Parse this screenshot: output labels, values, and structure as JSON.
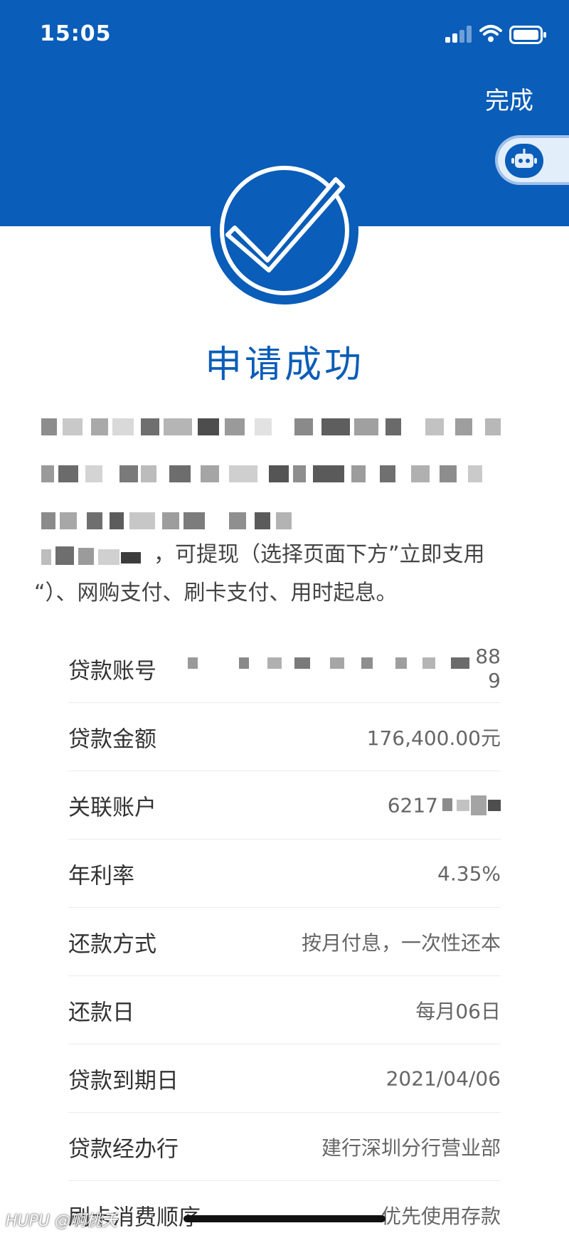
{
  "status_bar": {
    "time": "15:05",
    "icons": [
      "signal-icon",
      "wifi-icon",
      "battery-icon"
    ]
  },
  "header": {
    "done_label": "完成",
    "assistant_icon": "robot-icon",
    "bg_color": "#0a5db8"
  },
  "result": {
    "icon": "check-circle-icon",
    "title": "申请成功"
  },
  "description": {
    "line1": "，可提现（选择页面下方”立即支用",
    "line2": "“）、网购支付、刷卡支付、用时起息。"
  },
  "info": {
    "loan_account": {
      "label": "贷款账号",
      "value_tail1": "88",
      "value_tail2": "9"
    },
    "loan_amount": {
      "label": "贷款金额",
      "value": "176,400.00元"
    },
    "linked_account": {
      "label": "关联账户",
      "value": "6217"
    },
    "annual_rate": {
      "label": "年利率",
      "value": "4.35%"
    },
    "repay_method": {
      "label": "还款方式",
      "value": "按月付息，一次性还本"
    },
    "repay_day": {
      "label": "还款日",
      "value": "每月06日"
    },
    "due_date": {
      "label": "贷款到期日",
      "value": "2021/04/06"
    },
    "branch": {
      "label": "贷款经办行",
      "value": "建行深圳分行营业部"
    },
    "card_order": {
      "label": "刷卡消费顺序",
      "value": "优先使用存款"
    }
  },
  "watermark": "HUPU @啊桃夭"
}
